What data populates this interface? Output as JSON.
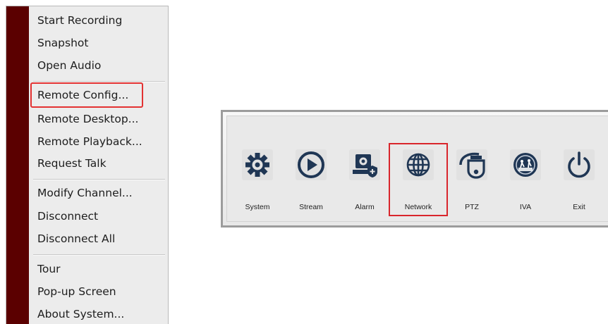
{
  "context_menu": {
    "items": [
      {
        "label": "Start Recording"
      },
      {
        "label": "Snapshot"
      },
      {
        "label": "Open Audio"
      },
      {
        "label": "Remote Config..."
      },
      {
        "label": "Remote Desktop..."
      },
      {
        "label": "Remote Playback..."
      },
      {
        "label": "Request Talk"
      },
      {
        "label": "Modify Channel..."
      },
      {
        "label": "Disconnect"
      },
      {
        "label": "Disconnect All"
      },
      {
        "label": "Tour"
      },
      {
        "label": "Pop-up Screen"
      },
      {
        "label": "About System..."
      }
    ],
    "highlighted_item": "Remote Config...",
    "strip_color": "#5b0000",
    "highlight_color": "#e33232"
  },
  "toolbar": {
    "tools": [
      {
        "label": "System",
        "icon": "gear-icon"
      },
      {
        "label": "Stream",
        "icon": "play-icon"
      },
      {
        "label": "Alarm",
        "icon": "alarm-camera-icon"
      },
      {
        "label": "Network",
        "icon": "globe-icon"
      },
      {
        "label": "PTZ",
        "icon": "ptz-camera-icon"
      },
      {
        "label": "IVA",
        "icon": "iva-icon"
      },
      {
        "label": "Exit",
        "icon": "power-icon"
      }
    ],
    "highlighted_tool": "Network",
    "icon_color": "#1f3654",
    "highlight_color": "#d9262c"
  }
}
